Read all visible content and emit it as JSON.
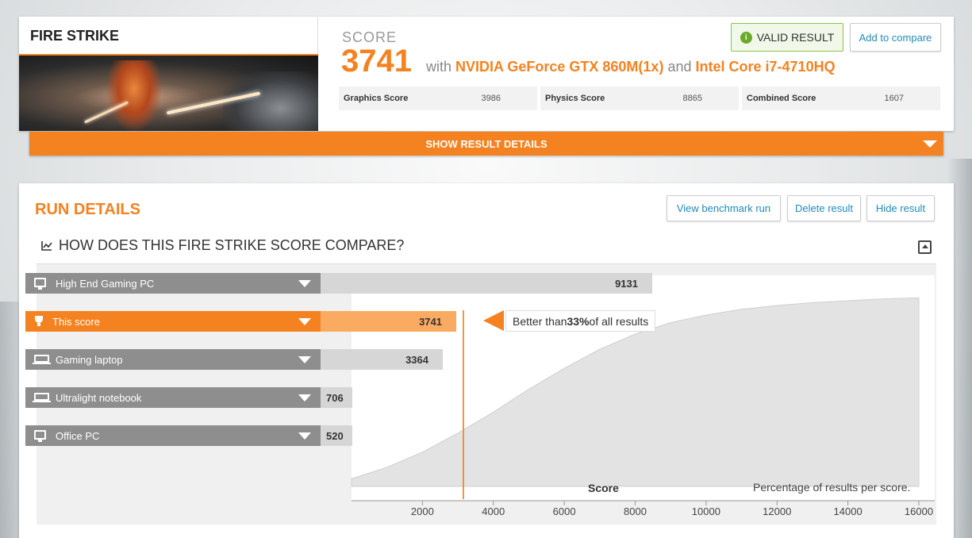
{
  "top": {
    "bench_title": "FIRE STRIKE",
    "score_label": "SCORE",
    "score_value": "3741",
    "with": "with",
    "gpu": "NVIDIA GeForce GTX 860M(1x)",
    "and": "and",
    "cpu": "Intel Core i7-4710HQ",
    "valid_label": "VALID RESULT",
    "compare_label": "Add to compare",
    "subscores": [
      {
        "name": "Graphics Score",
        "value": "3986"
      },
      {
        "name": "Physics Score",
        "value": "8865"
      },
      {
        "name": "Combined Score",
        "value": "1607"
      }
    ],
    "details_label": "SHOW RESULT DETAILS"
  },
  "run": {
    "title": "RUN DETAILS",
    "view_label": "View benchmark run",
    "delete_label": "Delete result",
    "hide_label": "Hide result",
    "compare_title": "HOW DOES THIS FIRE STRIKE SCORE COMPARE?"
  },
  "chart_data": {
    "type": "bar",
    "categories": [
      "High End Gaming PC",
      "This score",
      "Gaming laptop",
      "Ultralight notebook",
      "Office PC"
    ],
    "values": [
      9131,
      3741,
      3364,
      706,
      520
    ],
    "highlight": "This score",
    "callout": {
      "prefix": "Better than ",
      "percent": "33%",
      "suffix": " of all results"
    },
    "xlabel": "Score",
    "note": "Percentage of results per score.",
    "x_ticks": [
      "2000",
      "4000",
      "6000",
      "8000",
      "10000",
      "12000",
      "14000",
      "16000"
    ],
    "xlim": [
      0,
      16000
    ],
    "distribution_curve": {
      "x": [
        0,
        1000,
        2000,
        3000,
        4000,
        5000,
        6000,
        7000,
        8000,
        9000,
        10000,
        11000,
        12000,
        13000,
        14000,
        15000,
        16000
      ],
      "y": [
        0.04,
        0.1,
        0.18,
        0.28,
        0.39,
        0.51,
        0.62,
        0.72,
        0.8,
        0.86,
        0.9,
        0.93,
        0.95,
        0.965,
        0.975,
        0.985,
        0.99
      ]
    },
    "colors": {
      "accent": "#f58220",
      "highlight_bar": "#fbaa62",
      "bar": "#d6d6d6",
      "label_bg": "#8e8e8e",
      "curve_fill": "#e3e3e3"
    }
  },
  "icons": {
    "valid": "check-circle-icon",
    "section": "line-chart-icon",
    "collapse": "collapse-up-icon",
    "rows": [
      "desktop-icon",
      "trophy-icon",
      "laptop-icon",
      "laptop-icon",
      "desktop-icon"
    ]
  }
}
